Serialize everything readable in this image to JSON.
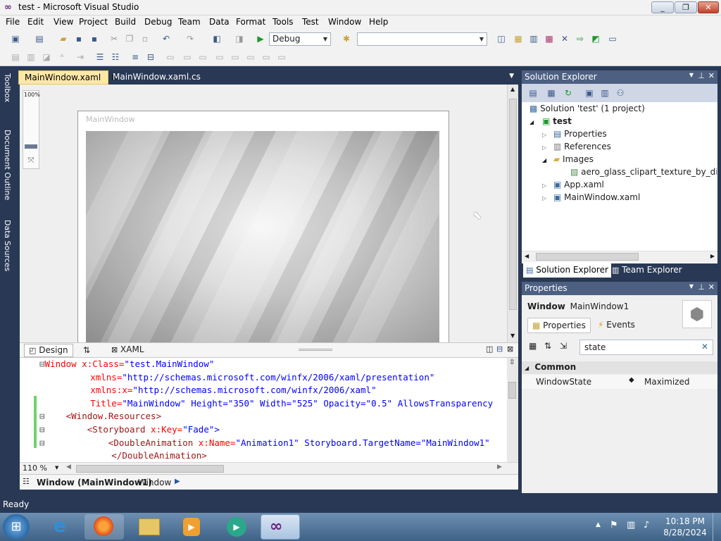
{
  "window": {
    "title": "test - Microsoft Visual Studio"
  },
  "menu": [
    "File",
    "Edit",
    "View",
    "Project",
    "Build",
    "Debug",
    "Team",
    "Data",
    "Format",
    "Tools",
    "Test",
    "Window",
    "Help"
  ],
  "toolbar": {
    "config_value": "Debug",
    "platform_value": ""
  },
  "sidetabs": [
    "Toolbox",
    "Document Outline",
    "Data Sources"
  ],
  "doc_tabs": [
    {
      "label": "MainWindow.xaml"
    },
    {
      "label": "MainWindow.xaml.cs"
    }
  ],
  "designer": {
    "zoom_value": "100%",
    "window_caption": "MainWindow"
  },
  "split": {
    "design_label": "Design",
    "swap_label": "⇅",
    "xaml_label": "XAML"
  },
  "code": [
    {
      "t1": "Window",
      "t2": " x:Class=",
      "t3": "\"test.MainWindow\""
    },
    {
      "t1": "",
      "t2": "        xmlns=",
      "t3": "\"http://schemas.microsoft.com/winfx/2006/xaml/presentation\""
    },
    {
      "t1": "",
      "t2": "        xmlns:x=",
      "t3": "\"http://schemas.microsoft.com/winfx/2006/xaml\""
    },
    {
      "t1": "",
      "t2": "        Title=",
      "t3": "\"MainWindow\" Height=\"350\" Width=\"525\" Opacity=\"0.5\" AllowsTransparency"
    },
    {
      "t1": "    <Window.Resources>",
      "t2": "",
      "t3": ""
    },
    {
      "t1": "        <Storyboard",
      "t2": " x:Key=",
      "t3": "\"Fade\">"
    },
    {
      "t1": "            <DoubleAnimation",
      "t2": " x:Name=",
      "t3": "\"Animation1\" Storyboard.TargetName=\"MainWindow1\""
    },
    {
      "t1": "            </DoubleAnimation>",
      "t2": "",
      "t3": ""
    }
  ],
  "editor_status": {
    "zoom": "110 %"
  },
  "pathbar": {
    "element": "Window (MainWindow1)",
    "type": "Window"
  },
  "solution_explorer": {
    "title": "Solution Explorer",
    "items": [
      {
        "label": "Solution 'test' (1 project)"
      },
      {
        "label": "test"
      },
      {
        "label": "Properties"
      },
      {
        "label": "References"
      },
      {
        "label": "Images"
      },
      {
        "label": "aero_glass_clipart_texture_by_diamo"
      },
      {
        "label": "App.xaml"
      },
      {
        "label": "MainWindow.xaml"
      }
    ],
    "tabs": [
      "Solution Explorer",
      "Team Explorer"
    ]
  },
  "properties": {
    "title": "Properties",
    "object_type": "Window",
    "object_name": "MainWindow1",
    "tab_properties": "Properties",
    "tab_events": "Events",
    "search_value": "state",
    "category": "Common",
    "row_name": "WindowState",
    "row_value": "Maximized"
  },
  "status": {
    "text": "Ready"
  },
  "clock": {
    "time": "10:18 PM",
    "date": "8/28/2024"
  }
}
